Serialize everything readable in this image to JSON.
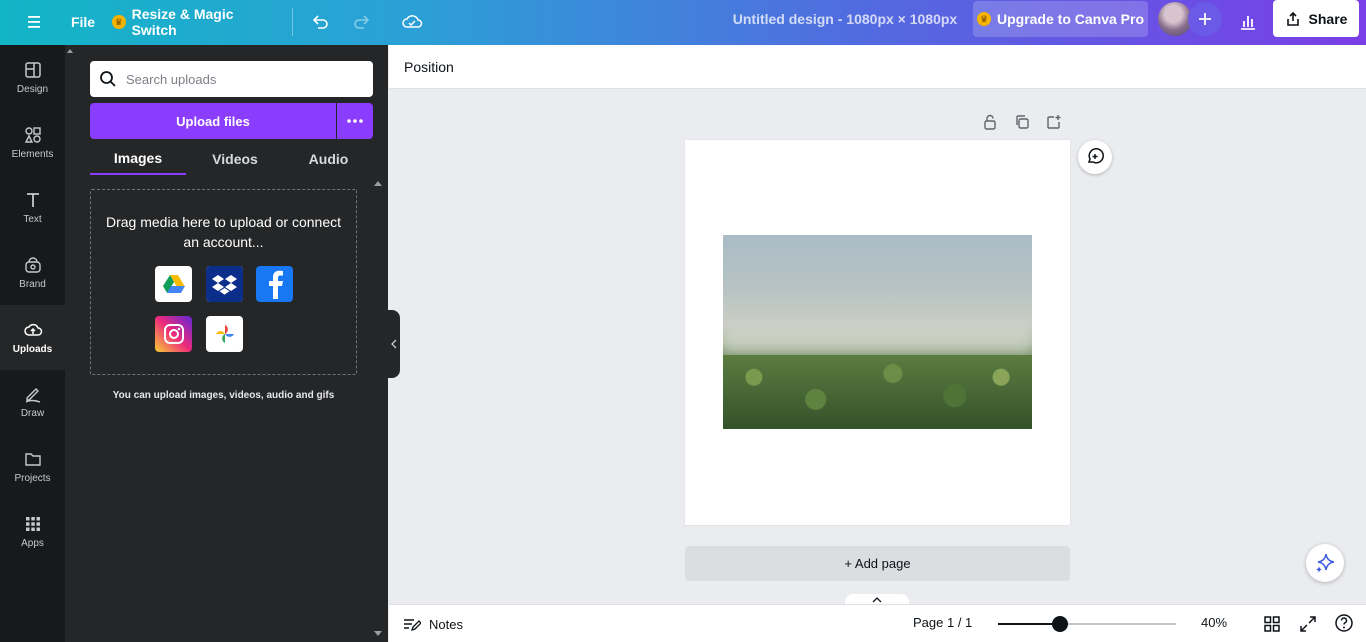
{
  "topbar": {
    "file_label": "File",
    "resize_label": "Resize & Magic Switch",
    "doc_title": "Untitled design - 1080px × 1080px",
    "upgrade_label": "Upgrade to Canva Pro",
    "share_label": "Share",
    "icons": [
      "menu-icon",
      "crown-icon",
      "undo-icon",
      "redo-icon",
      "cloud-save-icon",
      "plus-icon",
      "analytics-icon",
      "share-icon"
    ]
  },
  "rail": {
    "items": [
      {
        "label": "Design",
        "icon": "design-icon"
      },
      {
        "label": "Elements",
        "icon": "elements-icon"
      },
      {
        "label": "Text",
        "icon": "text-icon"
      },
      {
        "label": "Brand",
        "icon": "brand-icon"
      },
      {
        "label": "Uploads",
        "icon": "uploads-icon",
        "active": true
      },
      {
        "label": "Draw",
        "icon": "draw-icon"
      },
      {
        "label": "Projects",
        "icon": "projects-icon"
      },
      {
        "label": "Apps",
        "icon": "apps-icon"
      }
    ]
  },
  "uploads": {
    "search_placeholder": "Search uploads",
    "upload_label": "Upload files",
    "tabs": [
      {
        "label": "Images",
        "active": true
      },
      {
        "label": "Videos"
      },
      {
        "label": "Audio"
      }
    ],
    "drop_text": "Drag media here to upload or connect an account...",
    "sources": [
      "Google Drive",
      "Dropbox",
      "Facebook",
      "Instagram",
      "Google Photos"
    ],
    "hint": "You can upload images, videos, audio and gifs"
  },
  "context_bar": {
    "position_label": "Position"
  },
  "canvas": {
    "add_page_label": "+ Add page"
  },
  "bottombar": {
    "notes_label": "Notes",
    "page_count": "Page 1 / 1",
    "zoom_level": 40,
    "zoom_label": "40%",
    "zoom_slider_fraction": 0.35
  },
  "colors": {
    "accent": "#8b3dff",
    "panel_bg": "#252627",
    "rail_bg": "#18191b"
  }
}
